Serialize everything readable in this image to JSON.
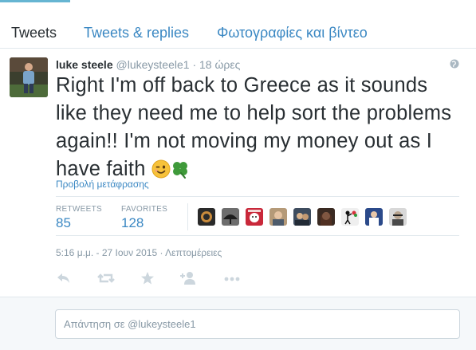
{
  "tabs": [
    {
      "label": "Tweets",
      "active": true
    },
    {
      "label": "Tweets & replies",
      "active": false
    },
    {
      "label": "Φωτογραφίες και βίντεο",
      "active": false
    }
  ],
  "tweet": {
    "author_name": "luke steele",
    "author_handle": "@lukeysteele1",
    "separator": "·",
    "relative_time": "18 ώρες",
    "text": "Right I'm off back to Greece as it sounds like they need me to help sort the problems again!! I'm not moving my money out as I have faith",
    "emojis": [
      "winking-face",
      "four-leaf-clover"
    ],
    "translate_link": "Προβολή μετάφρασης",
    "stats": {
      "retweets_label": "RETWEETS",
      "retweets_value": "85",
      "favorites_label": "FAVORITES",
      "favorites_value": "128"
    },
    "timestamp": "5:16 μ.μ. - 27 Ιουν 2015",
    "timestamp_separator": " · ",
    "details_link": "Λεπτομέρειες",
    "actions": [
      "reply-icon",
      "retweet-icon",
      "favorite-icon",
      "follow-icon",
      "more-icon"
    ]
  },
  "reply": {
    "placeholder": "Απάντηση σε @lukeysteele1"
  },
  "colors": {
    "link_blue": "#3b88c3",
    "muted_gray": "#8899a6",
    "text_dark": "#292f33",
    "border": "#e1e8ed"
  }
}
